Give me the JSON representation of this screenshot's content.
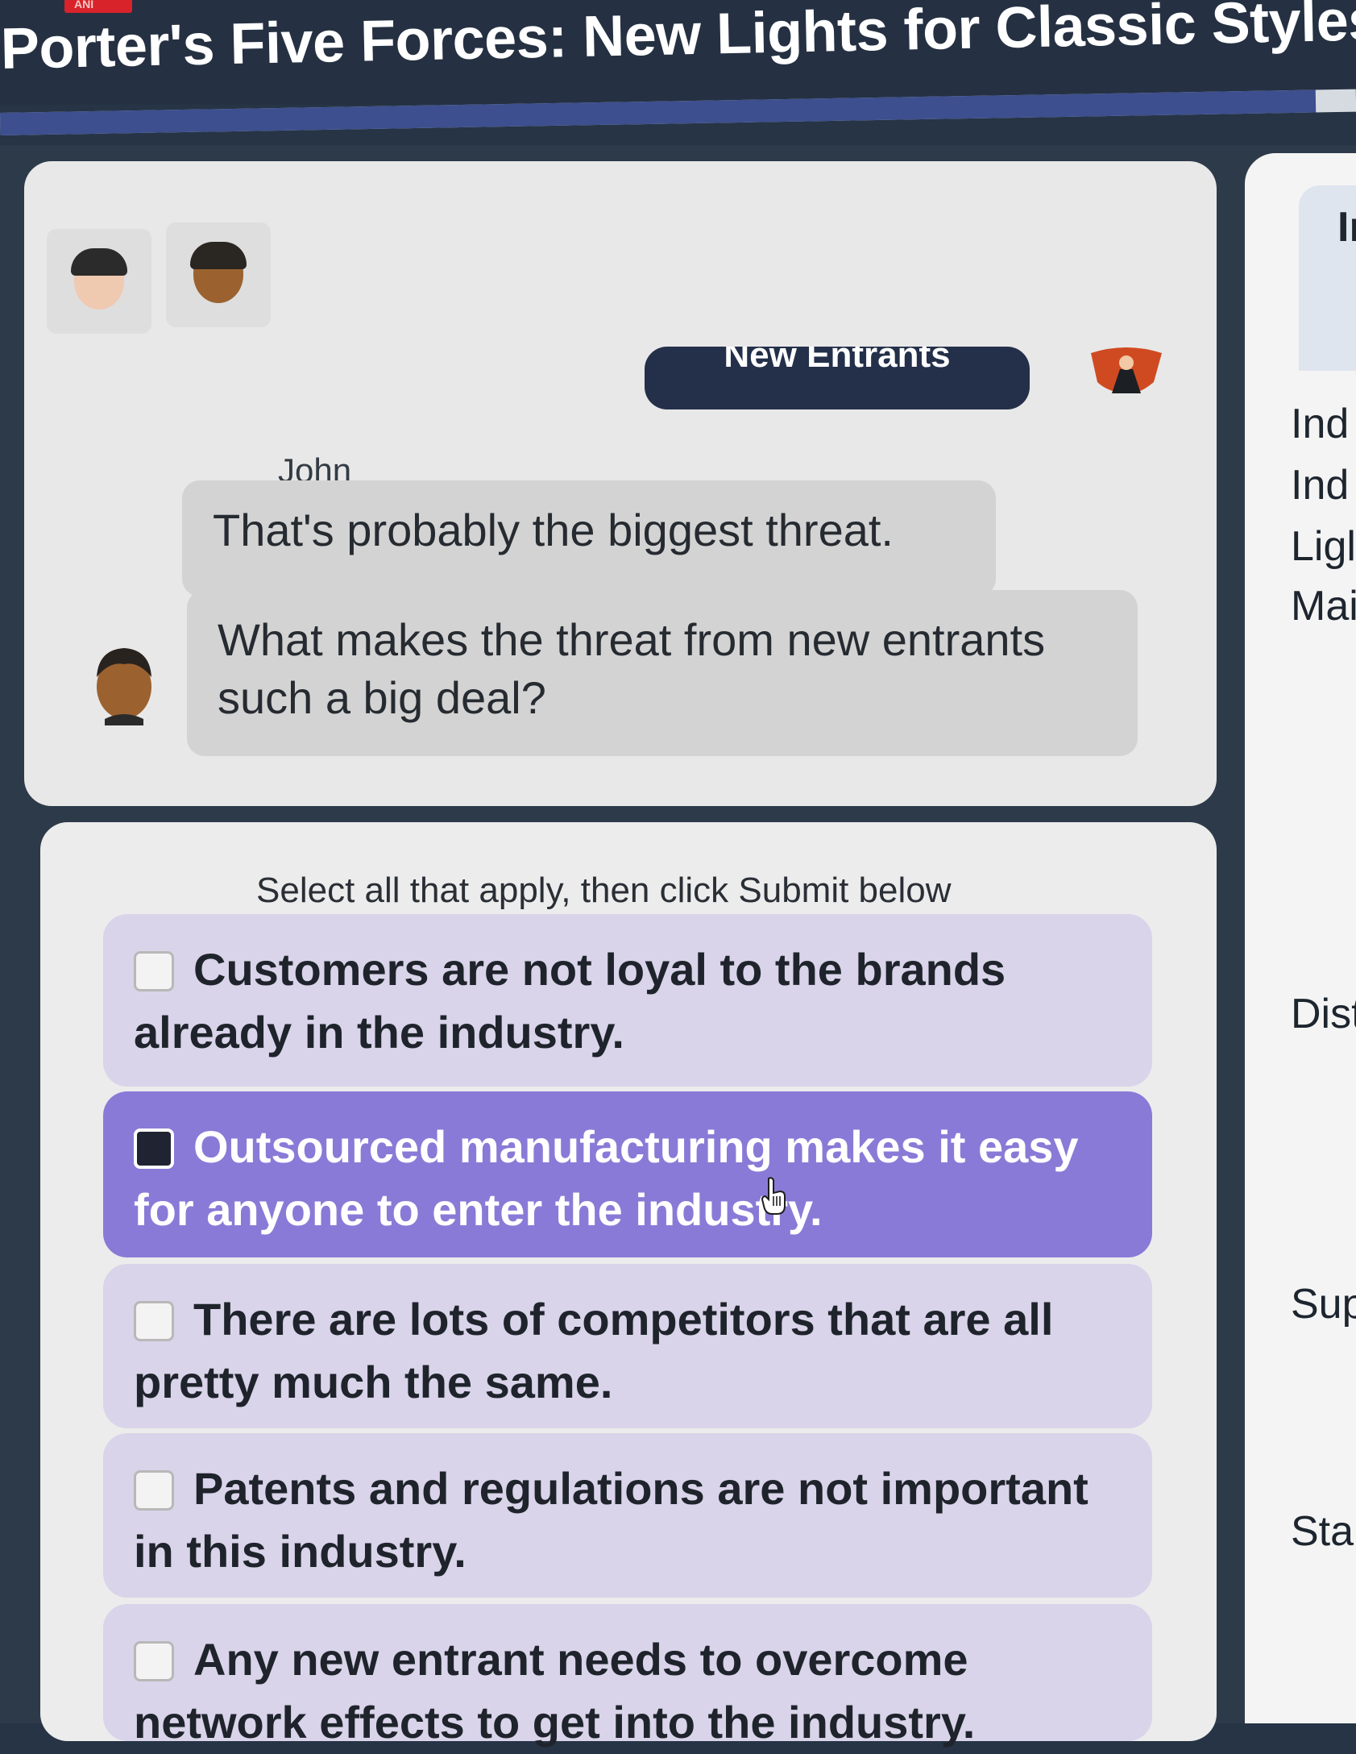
{
  "app": {
    "brand_label": "ANI",
    "title": "Porter's Five Forces: New Lights for Classic Styles",
    "progress": 0.97
  },
  "dialog": {
    "topic_pill": "New Entrants",
    "speaker": "John",
    "messages": [
      "That's probably the biggest threat.",
      "What makes the threat from new entrants such a big deal?"
    ]
  },
  "quiz": {
    "instruction": "Select all that apply, then click Submit below",
    "options": [
      {
        "text": "Customers are not loyal to the brands already in the industry.",
        "selected": false
      },
      {
        "text": "Outsourced manufacturing makes it easy for anyone to enter the industry.",
        "selected": true
      },
      {
        "text": "There are lots of competitors that are all pretty much the same.",
        "selected": false
      },
      {
        "text": "Patents and regulations are not important in this industry.",
        "selected": false
      },
      {
        "text": "Any new entrant needs to overcome network effects to get into the industry.",
        "selected": false
      }
    ]
  },
  "right_panel": {
    "tab_label": "Ir",
    "items": [
      "Ind",
      "Ind",
      "Ligl",
      "Mai",
      "Dist",
      "Sup",
      "Star"
    ]
  },
  "icons": {
    "avatar_1": "woman-avatar-icon",
    "avatar_2": "man-avatar-icon",
    "host": "host-figure-icon",
    "cursor": "hand-cursor-icon"
  },
  "colors": {
    "background": "#263445",
    "selected_option": "#8a7ad7",
    "option": "#d9d4e9",
    "pill": "#24304a",
    "progress": "#3d4f8e"
  }
}
